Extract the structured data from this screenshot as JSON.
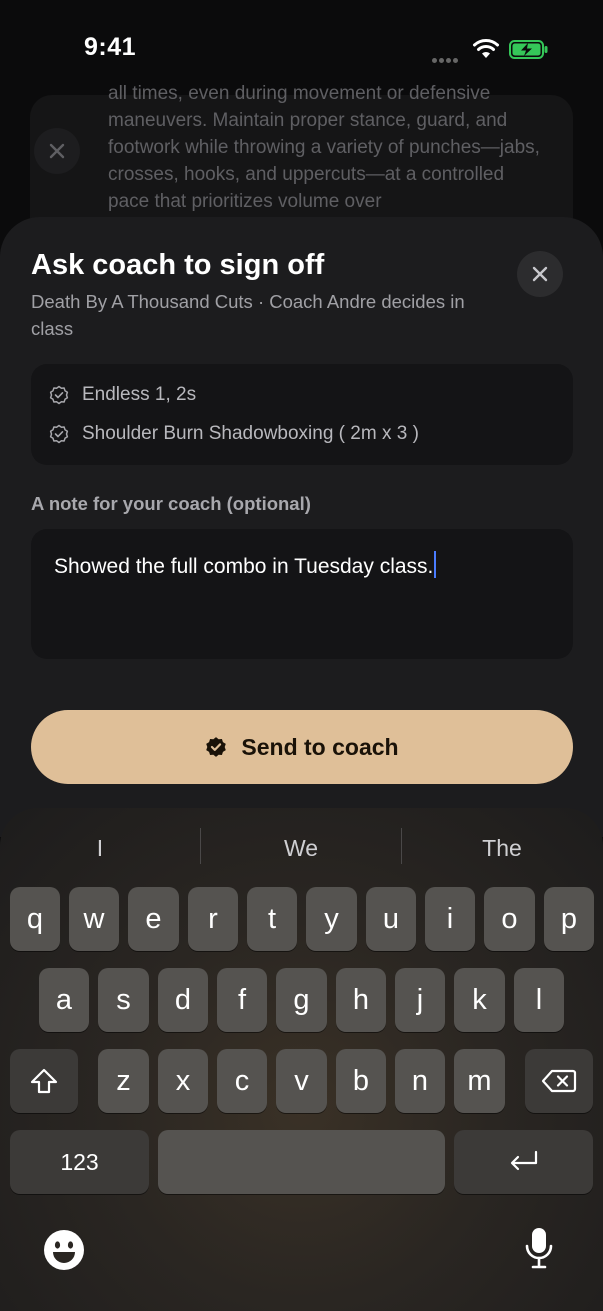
{
  "status_bar": {
    "time": "9:41"
  },
  "background": {
    "text": "all times, even during movement or defensive maneuvers. Maintain proper stance, guard, and footwork while throwing a variety of punches—jabs, crosses, hooks, and uppercuts—at a controlled pace that prioritizes volume over"
  },
  "sheet": {
    "title": "Ask coach to sign off",
    "subtitle": "Death By A Thousand Cuts · Coach Andre decides in class",
    "items": [
      {
        "label": "Endless 1, 2s",
        "icon": "verified-badge-icon"
      },
      {
        "label": "Shoulder Burn Shadowboxing ( 2m x 3 )",
        "icon": "verified-badge-icon"
      }
    ],
    "note_label": "A note for your coach (optional)",
    "note_value": "Showed the full combo in Tuesday class.",
    "send_label": "Send to coach",
    "accent": "#dfbf98"
  },
  "keyboard": {
    "suggestions": [
      "I",
      "We",
      "The"
    ],
    "row1": [
      "q",
      "w",
      "e",
      "r",
      "t",
      "y",
      "u",
      "i",
      "o",
      "p"
    ],
    "row2": [
      "a",
      "s",
      "d",
      "f",
      "g",
      "h",
      "j",
      "k",
      "l"
    ],
    "row3": [
      "z",
      "x",
      "c",
      "v",
      "b",
      "n",
      "m"
    ],
    "numbers_key": "123"
  }
}
